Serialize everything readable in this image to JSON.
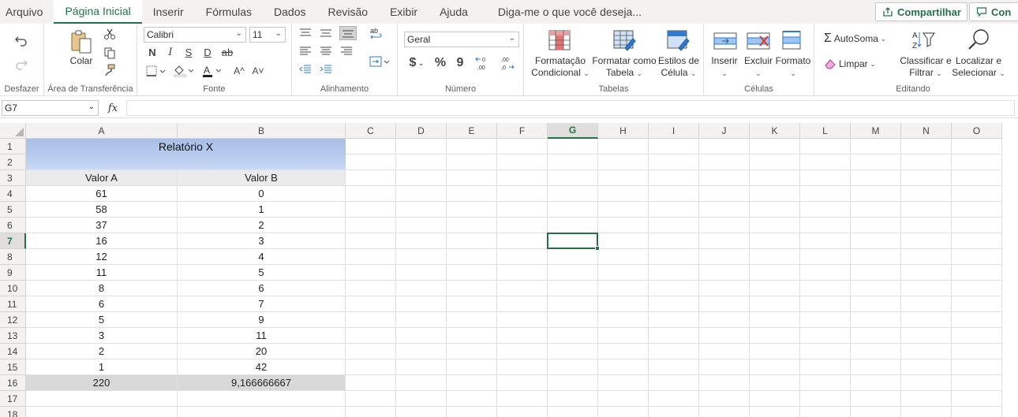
{
  "tabs": [
    "Arquivo",
    "Página Inicial",
    "Inserir",
    "Fórmulas",
    "Dados",
    "Revisão",
    "Exibir",
    "Ajuda"
  ],
  "active_tab": "Página Inicial",
  "tell_me": "Diga-me o que você deseja...",
  "share_label": "Compartilhar",
  "comments_label": "Con",
  "ribbon": {
    "undo_group": "Desfazer",
    "clipboard": {
      "label": "Área de Transferência",
      "paste": "Colar"
    },
    "font": {
      "label": "Fonte",
      "name": "Calibri",
      "size": "11",
      "bold": "N",
      "italic": "I",
      "underline": "S",
      "double_underline": "D",
      "strike": "ab",
      "grow": "A^",
      "shrink": "A˅"
    },
    "alignment": {
      "label": "Alinhamento",
      "wrap": "ab"
    },
    "number": {
      "label": "Número",
      "format": "Geral",
      "currency": "$",
      "percent": "%",
      "comma": "9",
      "inc_decimal": ",00",
      "dec_decimal": ",00"
    },
    "styles": {
      "label": "Tabelas",
      "cond_format_1": "Formatação",
      "cond_format_2": "Condicional",
      "format_table_1": "Formatar como",
      "format_table_2": "Tabela",
      "cell_styles_1": "Estilos de",
      "cell_styles_2": "Célula"
    },
    "cells": {
      "label": "Células",
      "insert": "Inserir",
      "delete": "Excluir",
      "format": "Formato"
    },
    "editing": {
      "label": "Editando",
      "autosum": "AutoSoma",
      "clear": "Limpar",
      "sort_1": "Classificar e",
      "sort_2": "Filtrar",
      "find_1": "Localizar e",
      "find_2": "Selecionar"
    }
  },
  "name_box": "G7",
  "fx": "fx",
  "columns": [
    "A",
    "B",
    "C",
    "D",
    "E",
    "F",
    "G",
    "H",
    "I",
    "J",
    "K",
    "L",
    "M",
    "N",
    "O"
  ],
  "selected_column": "G",
  "selected_row": 7,
  "rows": [
    1,
    2,
    3,
    4,
    5,
    6,
    7,
    8,
    9,
    10,
    11,
    12,
    13,
    14,
    15,
    16,
    17,
    18
  ],
  "sheet": {
    "title": "Relatório X",
    "headers": [
      "Valor A",
      "Valor B"
    ],
    "data": [
      [
        "61",
        "0"
      ],
      [
        "58",
        "1"
      ],
      [
        "37",
        "2"
      ],
      [
        "16",
        "3"
      ],
      [
        "12",
        "4"
      ],
      [
        "11",
        "5"
      ],
      [
        "8",
        "6"
      ],
      [
        "6",
        "7"
      ],
      [
        "5",
        "9"
      ],
      [
        "3",
        "11"
      ],
      [
        "2",
        "20"
      ],
      [
        "1",
        "42"
      ]
    ],
    "totals": [
      "220",
      "9,166666667"
    ]
  },
  "colors": {
    "accent": "#217346",
    "title_fill": "#b4c7e7",
    "header_fill": "#ebebeb",
    "total_fill": "#d9d9d9"
  }
}
